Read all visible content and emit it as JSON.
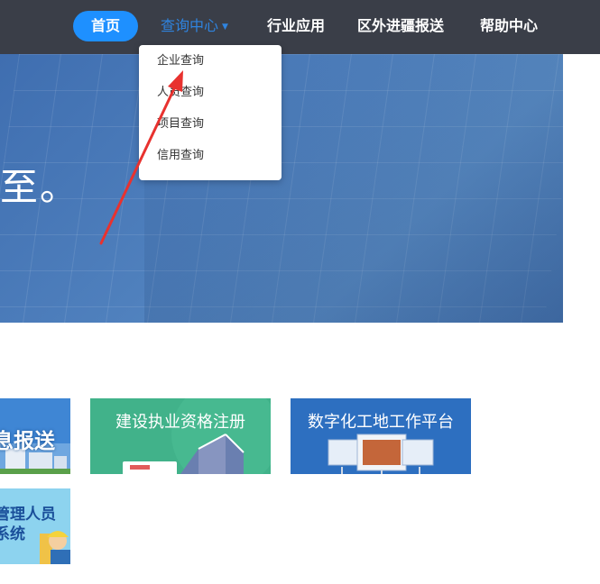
{
  "nav": {
    "home": "首页",
    "query": "查询中心",
    "industry": "行业应用",
    "report": "区外进疆报送",
    "help": "帮助中心"
  },
  "dropdown": {
    "items": [
      "企业查询",
      "人员查询",
      "项目查询",
      "信用查询"
    ]
  },
  "banner": {
    "text": "至。"
  },
  "cards": {
    "info": "息报送",
    "qualification": "建设执业资格注册",
    "digital": "数字化工地工作平台",
    "management": "管理人员\n系统"
  },
  "colors": {
    "nav_bg": "#3a3e48",
    "accent": "#1e90ff",
    "annotation": "#e8322f"
  }
}
